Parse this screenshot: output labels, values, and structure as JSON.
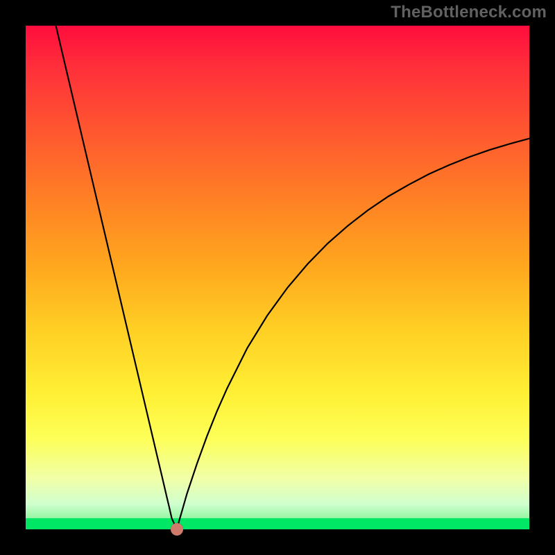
{
  "watermark": "TheBottleneck.com",
  "chart_data": {
    "type": "line",
    "title": "",
    "xlabel": "",
    "ylabel": "",
    "x_range": [
      0,
      100
    ],
    "y_range": [
      0,
      100
    ],
    "series": [
      {
        "name": "bottleneck-curve",
        "x": [
          6,
          8,
          10,
          12,
          14,
          16,
          18,
          20,
          22,
          24,
          26,
          27,
          28,
          28.5,
          29,
          29.5,
          30,
          30.5,
          31,
          32,
          34,
          36,
          38,
          40,
          44,
          48,
          52,
          56,
          60,
          64,
          68,
          72,
          76,
          80,
          84,
          88,
          92,
          96,
          100
        ],
        "values": [
          100,
          91.5,
          83,
          74.5,
          66,
          57.5,
          49,
          40.5,
          32,
          23.5,
          15,
          10.8,
          6.5,
          4.4,
          2.2,
          1.1,
          0,
          1.8,
          3.5,
          7,
          13,
          18.5,
          23.5,
          28,
          36,
          42.5,
          48,
          52.7,
          56.8,
          60.3,
          63.4,
          66.1,
          68.4,
          70.5,
          72.3,
          73.9,
          75.3,
          76.5,
          77.6
        ]
      }
    ],
    "min_point": {
      "x": 30,
      "y": 0
    },
    "background": {
      "type": "vertical-gradient",
      "stops": [
        {
          "pos": 0.0,
          "color": "#ff0c3d"
        },
        {
          "pos": 0.35,
          "color": "#ff8224"
        },
        {
          "pos": 0.6,
          "color": "#ffce24"
        },
        {
          "pos": 0.82,
          "color": "#fdff58"
        },
        {
          "pos": 0.95,
          "color": "#cfffce"
        },
        {
          "pos": 1.0,
          "color": "#00e765"
        }
      ]
    },
    "marker_color": "#cf7a6a",
    "curve_color": "#000000"
  }
}
